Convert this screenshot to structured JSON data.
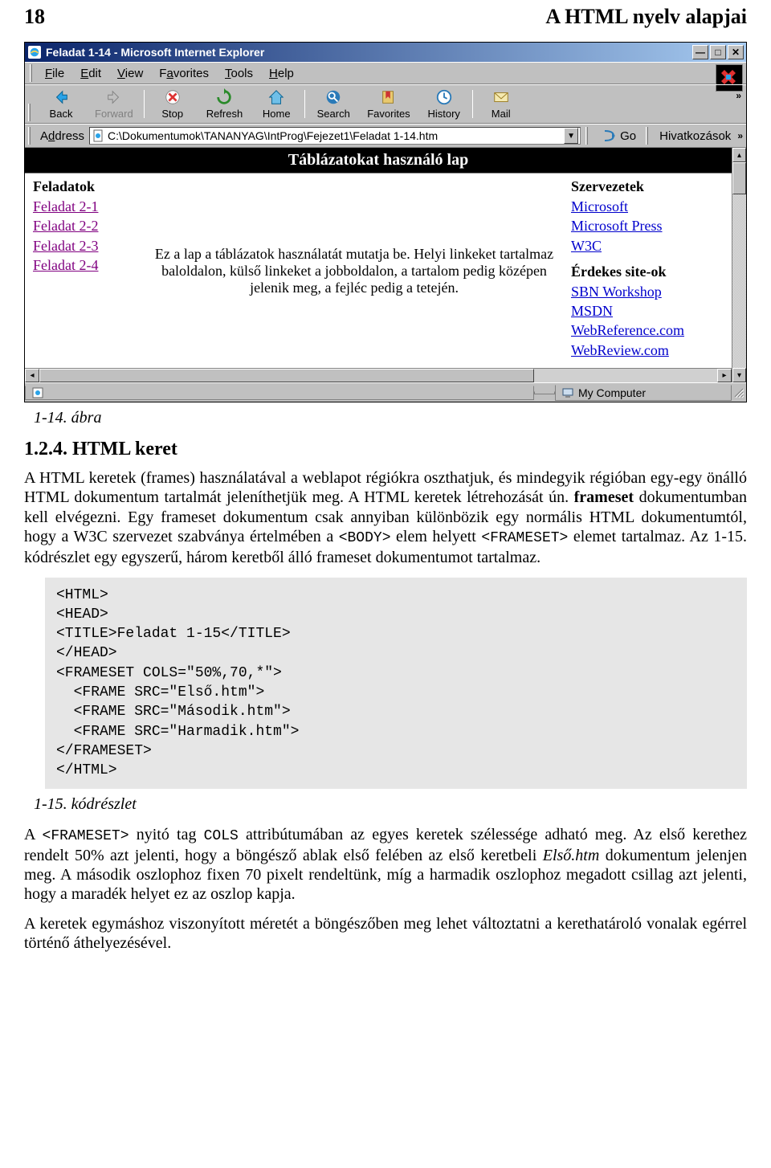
{
  "doc": {
    "page_number": "18",
    "chapter_title": "A HTML nyelv alapjai",
    "figure_caption": "1-14. ábra",
    "section_heading": "1.2.4. HTML keret",
    "para1_pre": "A HTML keretek (frames) használatával a weblapot régiókra oszthatjuk, és mindegyik régióban egy-egy önálló HTML dokumentum tartalmát jeleníthetjük meg. A HTML keretek létrehozását ún. ",
    "para1_bold": "frameset",
    "para1_mid1": " dokumentumban kell elvégezni. Egy frameset dokumentum csak annyiban különbözik egy normális HTML dokumentumtól, hogy a W3C szervezet szabványa értelmében a ",
    "para1_code1": "<BODY>",
    "para1_mid2": " elem helyett ",
    "para1_code2": "<FRAMESET>",
    "para1_end": " elemet tartalmaz. Az 1-15. kódrészlet egy egyszerű, három keretből álló frameset dokumentumot tartalmaz.",
    "code_listing": "<HTML>\n<HEAD>\n<TITLE>Feladat 1-15</TITLE>\n</HEAD>\n<FRAMESET COLS=\"50%,70,*\">\n  <FRAME SRC=\"Első.htm\">\n  <FRAME SRC=\"Második.htm\">\n  <FRAME SRC=\"Harmadik.htm\">\n</FRAMESET>\n</HTML>",
    "listing_caption": "1-15. kódrészlet",
    "para2_pre": "A ",
    "para2_code1": "<FRAMESET>",
    "para2_mid1": " nyitó tag ",
    "para2_code2": "COLS",
    "para2_mid2": " attribútumában az egyes keretek szélessége adható meg. Az első kerethez rendelt 50% azt jelenti, hogy a böngésző ablak első felében az első keretbeli ",
    "para2_em": "Első.htm",
    "para2_end": " dokumentum jelenjen meg. A második oszlophoz fixen 70 pixelt rendeltünk, míg a harmadik oszlophoz megadott csillag azt jelenti, hogy a maradék helyet ez az oszlop kapja.",
    "para3": "A keretek egymáshoz viszonyított méretét a böngészőben meg lehet változtatni a kerethatároló vonalak egérrel történő áthelyezésével."
  },
  "ie": {
    "title": "Feladat 1-14 - Microsoft Internet Explorer",
    "menus": [
      "File",
      "Edit",
      "View",
      "Favorites",
      "Tools",
      "Help"
    ],
    "toolbar": {
      "back": "Back",
      "forward": "Forward",
      "stop": "Stop",
      "refresh": "Refresh",
      "home": "Home",
      "search": "Search",
      "favorites": "Favorites",
      "history": "History",
      "mail": "Mail"
    },
    "address_label": "Address",
    "address_value": "C:\\Dokumentumok\\TANANYAG\\IntProg\\Fejezet1\\Feladat 1-14.htm",
    "go_label": "Go",
    "links_label": "Hivatkozások",
    "status_zone": "My Computer",
    "page": {
      "banner": "Táblázatokat használó lap",
      "left_heading": "Feladatok",
      "left_links": [
        "Feladat 2-1",
        "Feladat 2-2",
        "Feladat 2-3",
        "Feladat 2-4"
      ],
      "center_text": "Ez a lap a táblázatok használatát mutatja be. Helyi linkeket tartalmaz baloldalon, külső linkeket a jobboldalon, a tartalom pedig középen jelenik meg, a fejléc pedig a tetején.",
      "right_heading1": "Szervezetek",
      "right_links1": [
        "Microsoft",
        "Microsoft Press",
        "W3C"
      ],
      "right_heading2": "Érdekes site-ok",
      "right_links2": [
        "SBN Workshop",
        "MSDN",
        "WebReference.com",
        "WebReview.com"
      ]
    }
  }
}
